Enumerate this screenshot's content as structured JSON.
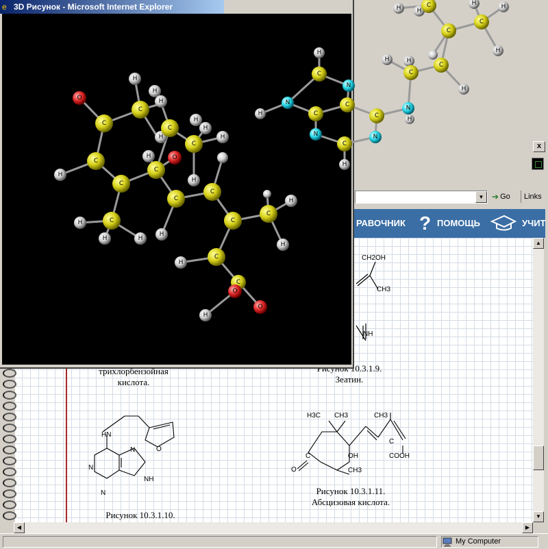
{
  "fg_window": {
    "title": "3D Рисунок - Microsoft Internet Explorer"
  },
  "bg_window": {
    "close_label": "x",
    "go_label": "Go",
    "links_label": "Links",
    "nav": {
      "reference": "РАВОЧНИК",
      "help": "ПОМОЩЬ",
      "teach": "УЧИТ",
      "help_icon": "?"
    }
  },
  "page": {
    "figures": [
      {
        "id": "fig9",
        "caption_number": "Рисунок 10.3.1.9.",
        "caption_name": "Зеатин."
      },
      {
        "id": "fig8",
        "caption_number": "трихлорбензойная",
        "caption_name": "кислота."
      },
      {
        "id": "fig10",
        "caption_number": "Рисунок 10.3.1.10."
      },
      {
        "id": "fig11",
        "caption_number": "Рисунок 10.3.1.11.",
        "caption_name": "Абсцизовая кислота."
      }
    ],
    "chem_labels": {
      "ch2oh": "CH2OH",
      "ch3": "CH3",
      "nh": "NH",
      "h3c": "H3C",
      "ch3b": "CH3",
      "ch3c": "CH3",
      "c1": "C",
      "c2": "C",
      "o": "O",
      "oh": "OH",
      "ch3d": "CH3",
      "cooh": "COOH",
      "hn": "HN",
      "n1": "N",
      "n2": "N",
      "n3": "N",
      "nh2": "NH",
      "o2": "O"
    }
  },
  "status": {
    "zone": "My Computer"
  },
  "colors": {
    "titlebar_start": "#0a246a",
    "titlebar_end": "#a6caf0",
    "carbon": "#d8d21a",
    "hydrogen": "#cfcfcf",
    "oxygen": "#e02828",
    "nitrogen": "#28d8e8",
    "nav_blue": "#3a6ea5"
  }
}
